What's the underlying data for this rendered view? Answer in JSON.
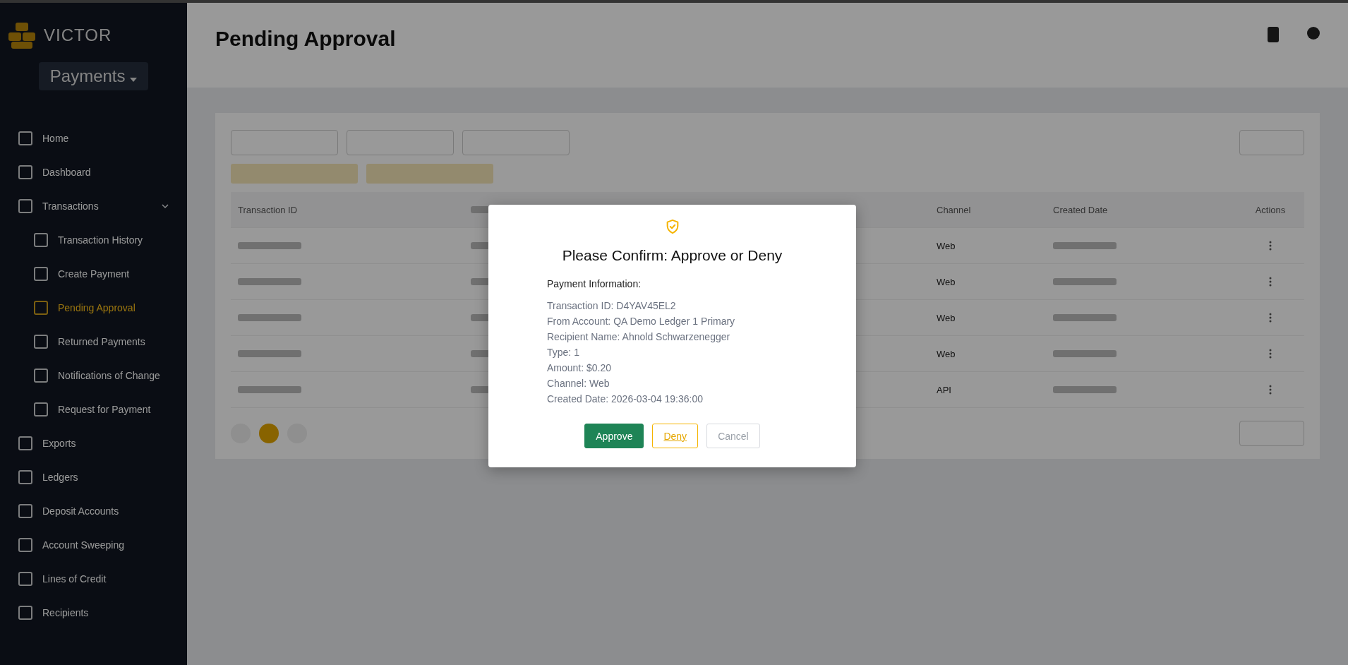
{
  "sidebar": {
    "brand": "VICTOR",
    "product": "Payments",
    "items": [
      {
        "label": "Home",
        "selected": false
      },
      {
        "label": "Dashboard",
        "selected": false
      },
      {
        "label": "Transactions",
        "selected": false,
        "expanded": true,
        "children": [
          {
            "label": "Transaction History",
            "selected": false
          },
          {
            "label": "Create Payment",
            "selected": false
          },
          {
            "label": "Pending Approval",
            "selected": true
          },
          {
            "label": "Returned Payments",
            "selected": false
          },
          {
            "label": "Notifications of Change",
            "selected": false
          },
          {
            "label": "Request for Payment",
            "selected": false
          }
        ]
      },
      {
        "label": "Exports",
        "selected": false
      },
      {
        "label": "Ledgers",
        "selected": false
      },
      {
        "label": "Deposit Accounts",
        "selected": false
      },
      {
        "label": "Account Sweeping",
        "selected": false
      },
      {
        "label": "Lines of Credit",
        "selected": false
      },
      {
        "label": "Recipients",
        "selected": false
      }
    ]
  },
  "header": {
    "title": "Pending Approval"
  },
  "table": {
    "columns": [
      "Transaction ID",
      "Channel",
      "Created Date",
      "Actions"
    ],
    "rows": [
      {
        "channel": "Web"
      },
      {
        "channel": "Web"
      },
      {
        "channel": "Web"
      },
      {
        "channel": "Web"
      },
      {
        "channel": "API"
      }
    ]
  },
  "dialog": {
    "title": "Please Confirm: Approve or Deny",
    "section": "Payment Information:",
    "details": [
      "Transaction ID: D4YAV45EL2",
      "From Account: QA Demo Ledger 1 Primary",
      "Recipient Name: Ahnold Schwarzenegger",
      "Type: 1",
      "Amount: $0.20",
      "Channel: Web",
      "Created Date: 2026-03-04 19:36:00"
    ],
    "buttons": [
      {
        "label": "Approve",
        "kind": "primary"
      },
      {
        "label": "Deny",
        "kind": "warning"
      },
      {
        "label": "Cancel",
        "kind": "secondary"
      }
    ]
  }
}
